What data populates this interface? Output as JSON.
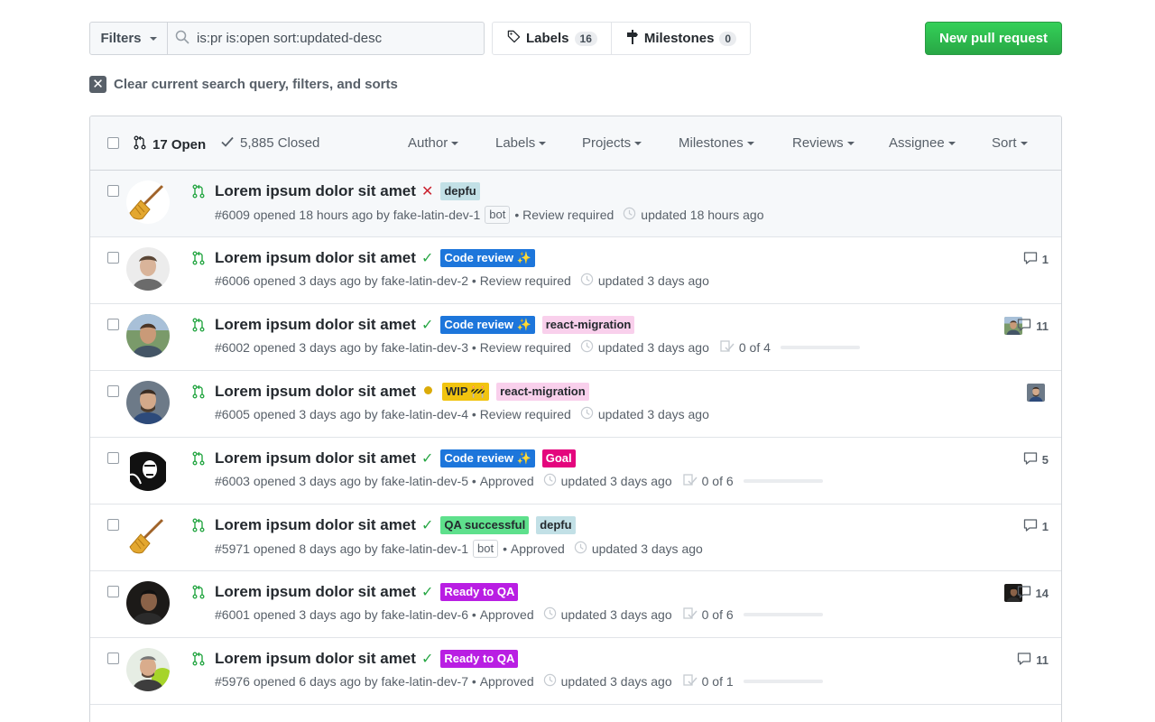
{
  "toolbar": {
    "filters_label": "Filters",
    "search_value": "is:pr is:open sort:updated-desc",
    "labels_label": "Labels",
    "labels_count": "16",
    "milestones_label": "Milestones",
    "milestones_count": "0",
    "new_pr_label": "New pull request"
  },
  "clear_query_label": "Clear current search query, filters, and sorts",
  "list_header": {
    "open_label": "17 Open",
    "closed_label": "5,885 Closed",
    "filters": [
      "Author",
      "Labels",
      "Projects",
      "Milestones",
      "Reviews",
      "Assignee",
      "Sort"
    ]
  },
  "pull_requests": [
    {
      "title": "Lorem ipsum dolor sit amet",
      "status": "failure",
      "labels": [
        {
          "text": "depfu",
          "bg": "#c2e0e6",
          "fg": "#24292e"
        }
      ],
      "number": "#6009",
      "opened": "opened 18 hours ago by",
      "author": "fake-latin-dev-1",
      "bot": "bot",
      "review": "Review required",
      "updated": "updated 18 hours ago",
      "tasks": "",
      "comments": "",
      "avatar": "broom"
    },
    {
      "title": "Lorem ipsum dolor sit amet",
      "status": "success",
      "labels": [
        {
          "text": "Code review ✨",
          "bg": "#1d76db",
          "fg": "#ffffff"
        }
      ],
      "number": "#6006",
      "opened": "opened 3 days ago by",
      "author": "fake-latin-dev-2",
      "bot": "",
      "review": "Review required",
      "updated": "updated 3 days ago",
      "tasks": "",
      "comments": "1",
      "avatar": "person-light"
    },
    {
      "title": "Lorem ipsum dolor sit amet",
      "status": "success",
      "labels": [
        {
          "text": "Code review ✨",
          "bg": "#1d76db",
          "fg": "#ffffff"
        },
        {
          "text": "react-migration",
          "bg": "#f9d0ec",
          "fg": "#24292e"
        }
      ],
      "number": "#6002",
      "opened": "opened 3 days ago by",
      "author": "fake-latin-dev-3",
      "bot": "",
      "review": "Review required",
      "updated": "updated 3 days ago",
      "tasks": "0 of 4",
      "comments": "11",
      "avatar": "person-outdoor"
    },
    {
      "title": "Lorem ipsum dolor sit amet",
      "status": "pending",
      "labels": [
        {
          "text": "WIP 🚧",
          "bg": "#f1c40f",
          "fg": "#24292e"
        },
        {
          "text": "react-migration",
          "bg": "#f9d0ec",
          "fg": "#24292e"
        }
      ],
      "number": "#6005",
      "opened": "opened 3 days ago by",
      "author": "fake-latin-dev-4",
      "bot": "",
      "review": "Review required",
      "updated": "updated 3 days ago",
      "tasks": "",
      "comments": "",
      "avatar": "person-blue"
    },
    {
      "title": "Lorem ipsum dolor sit amet",
      "status": "success",
      "labels": [
        {
          "text": "Code review ✨",
          "bg": "#1d76db",
          "fg": "#ffffff"
        },
        {
          "text": "Goal",
          "bg": "#e4067d",
          "fg": "#ffffff"
        }
      ],
      "number": "#6003",
      "opened": "opened 3 days ago by",
      "author": "fake-latin-dev-5",
      "bot": "",
      "review": "Approved",
      "updated": "updated 3 days ago",
      "tasks": "0 of 6",
      "comments": "5",
      "avatar": "person-bw"
    },
    {
      "title": "Lorem ipsum dolor sit amet",
      "status": "success",
      "labels": [
        {
          "text": "QA successful",
          "bg": "#5ee08c",
          "fg": "#24292e"
        },
        {
          "text": "depfu",
          "bg": "#c2e0e6",
          "fg": "#24292e"
        }
      ],
      "number": "#5971",
      "opened": "opened 8 days ago by",
      "author": "fake-latin-dev-1",
      "bot": "bot",
      "review": "Approved",
      "updated": "updated 3 days ago",
      "tasks": "",
      "comments": "1",
      "avatar": "broom"
    },
    {
      "title": "Lorem ipsum dolor sit amet",
      "status": "success",
      "labels": [
        {
          "text": "Ready to QA",
          "bg": "#b91ee3",
          "fg": "#ffffff"
        }
      ],
      "number": "#6001",
      "opened": "opened 3 days ago by",
      "author": "fake-latin-dev-6",
      "bot": "",
      "review": "Approved",
      "updated": "updated 3 days ago",
      "tasks": "0 of 6",
      "comments": "14",
      "avatar": "person-dark"
    },
    {
      "title": "Lorem ipsum dolor sit amet",
      "status": "success",
      "labels": [
        {
          "text": "Ready to QA",
          "bg": "#b91ee3",
          "fg": "#ffffff"
        }
      ],
      "number": "#5976",
      "opened": "opened 6 days ago by",
      "author": "fake-latin-dev-7",
      "bot": "",
      "review": "Approved",
      "updated": "updated 3 days ago",
      "tasks": "0 of 1",
      "comments": "11",
      "avatar": "person-green"
    }
  ],
  "colors": {
    "accent_green": "#28a745",
    "failure_red": "#cb2431",
    "pending_yellow": "#dbab09",
    "muted_text": "#586069"
  }
}
